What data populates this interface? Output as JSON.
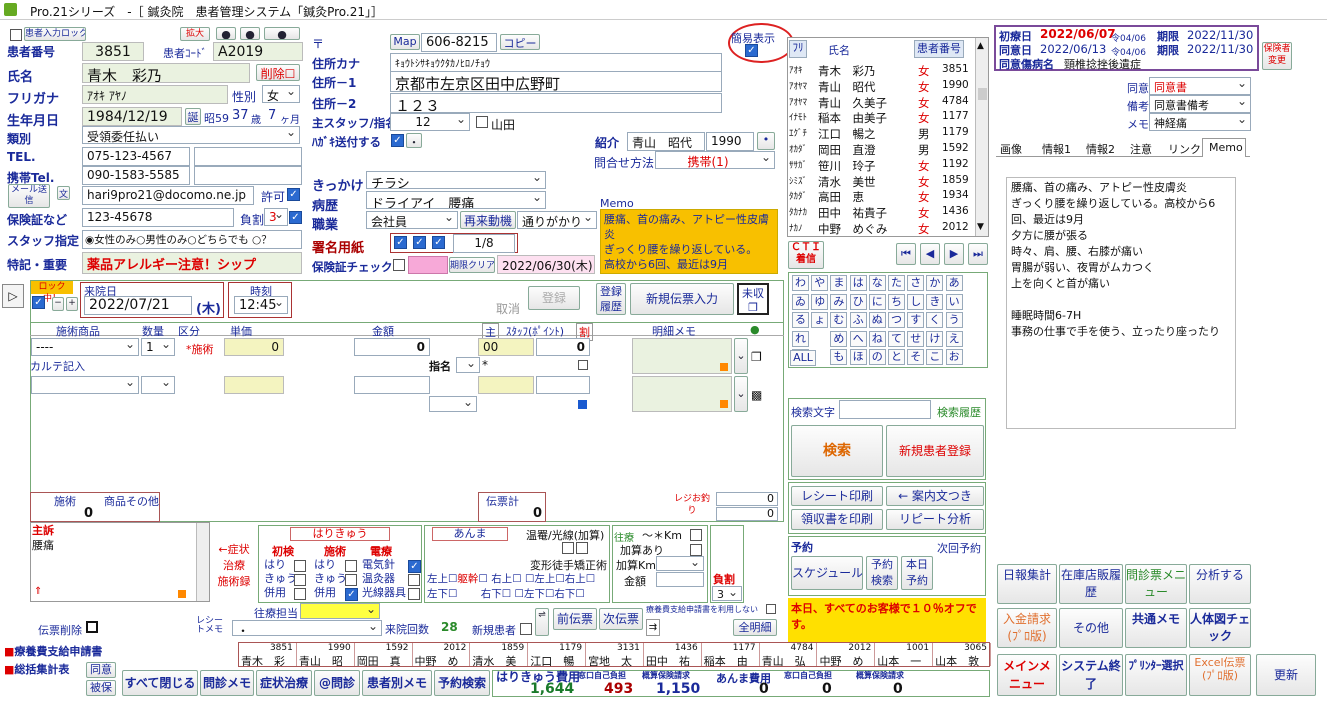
{
  "title": "Pro.21シリーズ　-［ 鍼灸院　患者管理システム「鍼灸Pro.21」］",
  "top": {
    "lock_label": "患者入力ロック",
    "enlarge": "拡大",
    "simple_view": "簡易表示"
  },
  "patient": {
    "id_label": "患者番号",
    "id": "3851",
    "code_label": "患者ｺｰﾄﾞ",
    "code": "A2019",
    "name_label": "氏名",
    "name": "青木　彩乃",
    "delete": "削除",
    "furigana_label": "フリガナ",
    "furigana": "ｱｵｷ ｱﾔﾉ",
    "sex_label": "性別",
    "sex": "女",
    "dob_label": "生年月日",
    "dob": "1984/12/19",
    "dob_tag": "誕",
    "era": "昭59",
    "age": "37",
    "age_u": "歳",
    "months": "7",
    "months_u": "ヶ月",
    "type_label": "類別",
    "type": "受領委任払い",
    "tel_label": "TEL.",
    "tel": "075-123-4567",
    "mobile_label": "携帯Tel.",
    "mobile": "090-1583-5585",
    "mail_btn": "メール送信",
    "mail_small": "文",
    "mail": "hari9pro21@docomo.ne.jp",
    "permit": "許可",
    "insurance_label": "保険証など",
    "insurance": "123-45678",
    "burden_label": "負割",
    "burden": "3",
    "staff_label": "スタッフ指定",
    "staff_opts": [
      "女性のみ",
      "男性のみ",
      "どちらでも",
      "？"
    ],
    "note_label": "特記・重要",
    "note": "薬品アレルギー注意！シップ"
  },
  "address": {
    "postal_mark": "〒",
    "map": "Map",
    "postal": "606-8215",
    "copy": "コピー",
    "kana_label": "住所カナ",
    "kana": "ｷｮｳﾄｼｻｷｮｳｸﾀｶﾉﾋﾛﾉﾁｮｳ",
    "addr1_label": "住所－1",
    "addr1": "京都市左京区田中広野町",
    "addr2_label": "住所－2",
    "addr2": "１２３",
    "main_staff_label": "主スタッフ/指名",
    "main_staff": "12",
    "staff_name": "山田",
    "postcard_label": "ﾊｶﾞｷ送付する",
    "postcard_dot": "・",
    "intro_label": "紹介",
    "intro_name": "青山　昭代",
    "intro_id": "1990",
    "intro_dot": "•",
    "inquiry_label": "問合せ方法",
    "inquiry": "携帯(1)",
    "trigger_label": "きっかけ",
    "trigger": "チラシ",
    "history_label": "病歴",
    "history": "ドライアイ　腰痛",
    "job_label": "職業",
    "job": "会社員",
    "revisit_label": "再来動機",
    "revisit": "通りがかり",
    "sign_label": "署名用紙",
    "sign_count": "1/8",
    "check_label": "保険証チェック",
    "expire_clear": "期限クリア",
    "expire": "2022/06/30(木)",
    "memo_label": "Memo",
    "memo": "腰痛、首の痛み、アトピー性皮膚炎\nぎっくり腰を繰り返している。\n高校から6回、最近は9月"
  },
  "patient_list": {
    "headers": [
      "ﾌﾘ",
      "氏名",
      "患者番号"
    ],
    "rows": [
      [
        "ｱｵｷ",
        "青木　彩乃",
        "女",
        "3851"
      ],
      [
        "ｱｵﾔﾏ",
        "青山　昭代",
        "女",
        "1990"
      ],
      [
        "ｱｵﾔﾏ",
        "青山　久美子",
        "女",
        "4784"
      ],
      [
        "ｲﾅﾓﾄ",
        "稲本　由美子",
        "女",
        "1177"
      ],
      [
        "ｴｸﾞﾁ",
        "江口　暢之",
        "男",
        "1179"
      ],
      [
        "ｵｶﾀﾞ",
        "岡田　直澄",
        "男",
        "1592"
      ],
      [
        "ｻｻｶﾞ",
        "笹川　玲子",
        "女",
        "1192"
      ],
      [
        "ｼﾐｽﾞ",
        "清水　美世",
        "女",
        "1859"
      ],
      [
        "ﾀｶﾀﾞ",
        "高田　恵",
        "女",
        "1934"
      ],
      [
        "ﾀｶﾅｶ",
        "田中　祐貴子",
        "女",
        "1436"
      ],
      [
        "ﾅｶﾉ",
        "中野　めぐみ",
        "女",
        "2012"
      ]
    ],
    "cti": "ＣＴＩ着信"
  },
  "kana_grid": [
    [
      "わ",
      "や",
      "ま",
      "は",
      "な",
      "た",
      "さ",
      "か",
      "あ"
    ],
    [
      "ゐ",
      "ゆ",
      "み",
      "ひ",
      "に",
      "ち",
      "し",
      "き",
      "い"
    ],
    [
      "る",
      "ょ",
      "む",
      "ふ",
      "ぬ",
      "つ",
      "す",
      "く",
      "う"
    ],
    [
      "れ",
      "",
      "め",
      "へ",
      "ね",
      "て",
      "せ",
      "け",
      "え"
    ],
    [
      "ろ",
      "",
      "も",
      "ほ",
      "の",
      "と",
      "そ",
      "こ",
      "お"
    ]
  ],
  "kana_all": "ALL",
  "search": {
    "label": "検索文字",
    "history": "検索履歴",
    "button": "検索",
    "new_patient": "新規患者登録",
    "receipt_print": "レシート印刷",
    "guide": "← 案内文つき",
    "recipt_print": "領収書を印刷",
    "repeat": "リピート分析"
  },
  "reservation": {
    "label": "予約",
    "next": "次回予約",
    "schedule": "スケジュール",
    "search": "予約検索",
    "today": "本日予約",
    "notice": "本日、すべてのお客様で１０％オフです。"
  },
  "info": {
    "first_label": "初療日",
    "first": "2022/06/07",
    "first_era": "令04/06",
    "first_limit_label": "期限",
    "first_limit": "2022/11/30",
    "same_label": "同意日",
    "same": "2022/06/13",
    "same_era": "令04/06",
    "same_limit_label": "期限",
    "same_limit": "2022/11/30",
    "disease_label": "同意傷病名",
    "disease": "頸椎捻挫後遺症",
    "insurer_change": "保険者変更",
    "consent_label": "同意",
    "consent": "同意書",
    "note_label": "備考",
    "note": "同意書備考",
    "memo_label": "メモ",
    "memo": "神経痛"
  },
  "tabs": [
    "画像",
    "情報1",
    "情報2",
    "注意",
    "リンク",
    "Memo"
  ],
  "memo_text": [
    "腰痛、首の痛み、アトピー性皮膚炎",
    "ぎっくり腰を繰り返している。高校から6",
    "回、最近は9月",
    "夕方に腰が張る",
    "時々、肩、腰、右膝が痛い",
    "胃腸が弱い、夜胃がムカつく",
    "上を向くと首が痛い",
    "",
    "睡眠時間6-7H",
    "事務の仕事で手を使う、立ったり座ったり"
  ],
  "visit": {
    "lock": "ロック中！",
    "visit_label": "来院日",
    "date": "2022/07/21",
    "dow": "(木)",
    "time_label": "時刻",
    "time": "12:45",
    "cancel": "取消",
    "register": "登録",
    "reg_history": "登録履歴",
    "new_slip": "新規伝票入力",
    "unpaid": "未収",
    "col_item": "施術商品",
    "col_qty": "数量",
    "col_kind": "区分",
    "col_price": "単価",
    "col_amount": "金額",
    "col_main": "主",
    "col_staff": "ｽﾀｯﾌ(ﾎﾟｲﾝﾄ)",
    "col_cut": "割",
    "col_memo": "明細メモ",
    "row1_item": "----",
    "row1_qty": "1",
    "row1_kind": "*施術",
    "row1_price": "0",
    "row1_amount": "0",
    "row1_staff": "00",
    "row1_cut": "0",
    "karte": "カルテ記入",
    "shimei": "指名",
    "star": "*",
    "sum_treat": "施術",
    "sum_goods": "商品その他",
    "sum_treat_v": "0",
    "slip_total": "伝票計",
    "slip_total_v": "0",
    "register_small": "レジお釣り",
    "change1": "0",
    "change2": "0"
  },
  "complaint": {
    "label": "主訴",
    "text": "腰痛",
    "symptom": "←症状",
    "cured": "治療",
    "hist": "施術録"
  },
  "harikyu": {
    "title": "はりきゅう",
    "first": "初検",
    "treat": "施術",
    "electric": "電療",
    "hari": "はり",
    "kyu": "きゅう",
    "both": "併用",
    "e1": "電気針",
    "e2": "温灸器",
    "e3": "光線器具"
  },
  "anma": {
    "title": "あんま",
    "warm": "温罨/光線(加算)",
    "deform": "変形徒手矯正術",
    "ul": "左上",
    "trunk": "躯幹",
    "ur": "右上",
    "ll": "左下",
    "lr": "右下",
    "ul2": "左上",
    "ur2": "右上",
    "ll2": "左下",
    "lr2": "右下"
  },
  "ouryo": {
    "title": "往療",
    "km": "〜＊Km",
    "add": "加算あり",
    "add_km": "加算Km",
    "amount": "金額",
    "burden": "負割",
    "burden_v": "3"
  },
  "bottom_row": {
    "staff": "往療担当",
    "receipt_memo": "レシートメモ",
    "dot": "・",
    "visits_label": "来院回数",
    "visits": "28",
    "new_label": "新規患者",
    "prev": "前伝票",
    "next": "次伝票",
    "sheet": "療養費支給申請書を利用しない",
    "all": "全明細",
    "delete_slip": "伝票削除"
  },
  "recent": [
    [
      "3851",
      "青木　彩"
    ],
    [
      "1990",
      "青山　昭"
    ],
    [
      "1592",
      "岡田　真"
    ],
    [
      "2012",
      "中野　め"
    ],
    [
      "1859",
      "清水　美"
    ],
    [
      "1179",
      "江口　暢"
    ],
    [
      "3131",
      "宮地　太"
    ],
    [
      "1436",
      "田中　祐"
    ],
    [
      "1177",
      "稲本　由"
    ],
    [
      "4784",
      "青山　弘"
    ],
    [
      "2012",
      "中野　め"
    ],
    [
      "1001",
      "山本　一"
    ],
    [
      "3065",
      "山本　敦"
    ]
  ],
  "left_btns": {
    "claim": "療養費支給申請書",
    "total": "総括集計表",
    "agree": "同意",
    "insured": "被保"
  },
  "footer": {
    "close_all": "すべて閉じる",
    "q_memo": "問診メモ",
    "sym": "症状治療",
    "at_q": "@問診",
    "p_memo": "患者別メモ",
    "res_search": "予約検索",
    "hk_label": "はりきゅう費用",
    "hk": "1,644",
    "self_label": "窓口自己負担",
    "self": "493",
    "est_label": "概算保険請求",
    "est": "1,150",
    "am_label": "あんま費用",
    "am": "0",
    "self2_label": "窓口自己負担",
    "self2": "0",
    "est2_label": "概算保険請求",
    "est2": "0"
  },
  "menu": {
    "daily": "日報集計",
    "stock": "在庫店販履歴",
    "q_menu": "問診票メニュー",
    "analysis": "分析する",
    "payment": "入金請求(ﾌﾟﾛ版)",
    "other": "その他",
    "common": "共通メモ",
    "body": "人体図チェック",
    "main": "メインメニュー",
    "sysend": "システム終了",
    "printer": "ﾌﾟﾘﾝﾀｰ選択",
    "excel": "Excel伝票(ﾌﾟﾛ版)",
    "update": "更新"
  }
}
